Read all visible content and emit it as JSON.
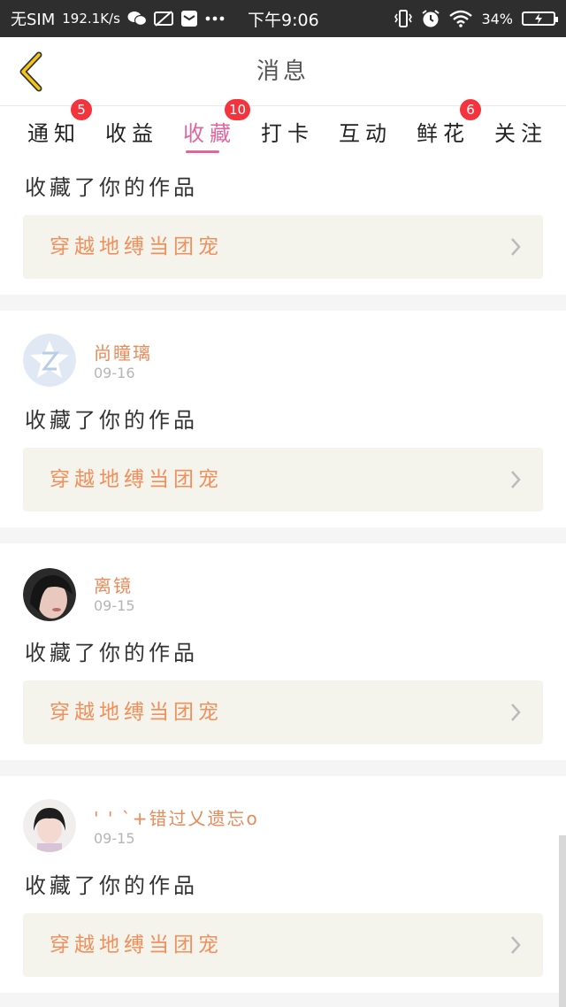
{
  "status_bar": {
    "sim": "无SIM",
    "speed": "192.1K/s",
    "time": "下午9:06",
    "battery": "34%"
  },
  "header": {
    "title": "消息"
  },
  "tabs": [
    {
      "label": "通知",
      "badge": "5"
    },
    {
      "label": "收益",
      "badge": ""
    },
    {
      "label": "收藏",
      "badge": "10",
      "active": true
    },
    {
      "label": "打卡",
      "badge": ""
    },
    {
      "label": "互动",
      "badge": ""
    },
    {
      "label": "鲜花",
      "badge": "6"
    },
    {
      "label": "关注",
      "badge": ""
    }
  ],
  "items": [
    {
      "user": "",
      "date": "",
      "action": "收藏了你的作品",
      "work": "穿越地缚当团宠"
    },
    {
      "user": "尚瞳璃",
      "date": "09-16",
      "action": "收藏了你的作品",
      "work": "穿越地缚当团宠"
    },
    {
      "user": "离镜",
      "date": "09-15",
      "action": "收藏了你的作品",
      "work": "穿越地缚当团宠"
    },
    {
      "user": "' ' ˋ+错过乂遗忘o",
      "date": "09-15",
      "action": "收藏了你的作品",
      "work": "穿越地缚当团宠"
    }
  ],
  "colors": {
    "accent": "#e0669e",
    "badge": "#f4333c",
    "work_text": "#f0905c",
    "username": "#e88b5a"
  }
}
